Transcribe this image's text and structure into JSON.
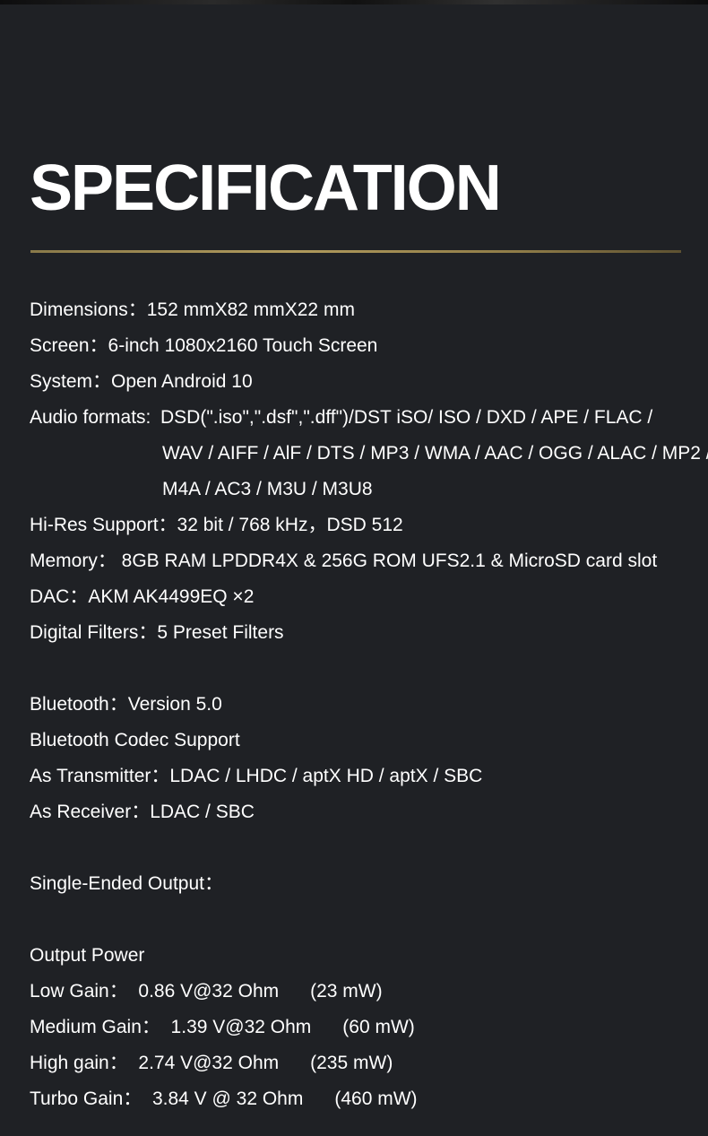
{
  "page": {
    "title": "SPECIFICATION"
  },
  "specs": {
    "dimensions": "Dimensions：152 mmX82 mmX22 mm",
    "screen": "Screen：6-inch 1080x2160 Touch Screen",
    "system": "System：Open Android 10",
    "audio_formats_label": "Audio formats:",
    "audio_formats_line1": "DSD(\".iso\",\".dsf\",\".dff\")/DST iSO/ ISO / DXD / APE / FLAC /",
    "audio_formats_line2": "WAV / AIFF / AlF / DTS / MP3 / WMA / AAC / OGG / ALAC / MP2 /",
    "audio_formats_line3": "M4A / AC3 / M3U / M3U8",
    "hires": "Hi-Res Support：32 bit / 768 kHz，DSD 512",
    "memory": "Memory： 8GB RAM LPDDR4X & 256G ROM UFS2.1 & MicroSD card slot",
    "dac": "DAC：AKM AK4499EQ ×2",
    "digital_filters": "Digital Filters：5 Preset Filters"
  },
  "bluetooth": {
    "version": "Bluetooth：Version 5.0",
    "codec_support": "Bluetooth Codec Support",
    "transmitter": "As Transmitter：LDAC / LHDC / aptX HD / aptX / SBC",
    "receiver": "As Receiver：LDAC / SBC"
  },
  "output": {
    "single_ended": "Single-Ended Output：",
    "power_heading": "Output Power",
    "low_gain": "Low Gain：  0.86 V@32 Ohm      (23 mW)",
    "medium_gain": "Medium Gain：  1.39 V@32 Ohm      (60 mW)",
    "high_gain": "High gain：  2.74 V@32 Ohm      (235 mW)",
    "turbo_gain": "Turbo Gain：  3.84 V @ 32 Ohm      (460 mW)"
  }
}
